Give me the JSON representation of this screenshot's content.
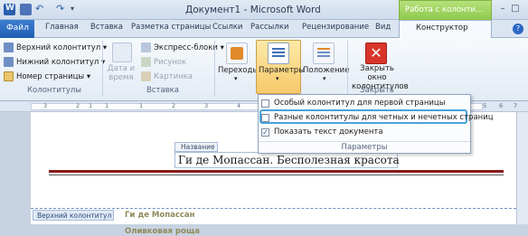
{
  "window": {
    "title": "Документ1  -  Microsoft Word",
    "context_tab": "Работа с колонти..."
  },
  "tabs": [
    "Главная",
    "Вставка",
    "Разметка страницы",
    "Ссылки",
    "Рассылки",
    "Рецензирование",
    "Вид"
  ],
  "file_tab": "Файл",
  "constructor_tab": "Конструктор",
  "ribbon": {
    "kolontituly": {
      "items": [
        "Верхний колонтитул ▾",
        "Нижний колонтитул ▾",
        "Номер страницы ▾"
      ],
      "label": "Колонтитулы"
    },
    "vstavka": {
      "date_time": [
        "Дата и",
        "время"
      ],
      "express": "Экспресс-блоки ▾",
      "picture": "Рисунок",
      "clipart": "Картинка",
      "label": "Вставка"
    },
    "perehody": "Переходы",
    "parametry": "Параметры",
    "polozhenie": "Положение",
    "close": [
      "Закрыть окно",
      "колонтитулов"
    ],
    "close_label": "Закрыть"
  },
  "dropdown": {
    "items": [
      {
        "label": "Особый колонтитул для первой страницы",
        "checked": false
      },
      {
        "label": "Разные колонтитулы для четных и нечетных страниц",
        "checked": false
      },
      {
        "label": "Показать текст документа",
        "checked": true
      }
    ],
    "footer": "Параметры"
  },
  "ruler_numbers": [
    "3",
    "1",
    "2",
    "1",
    "1",
    "2",
    "3",
    "4",
    "5",
    "6",
    "7"
  ],
  "document": {
    "name_tag": "Название",
    "title": "Ги де Мопассан. Бесполезная красота",
    "header_tag": "Верхний колонтитул",
    "author": "Ги де Мопассан",
    "subtitle": "Оливковая роща"
  },
  "colors": {
    "accent": "#2a5fa8",
    "context_green": "#8ec84d",
    "olive_text": "#8f8a5a",
    "dropdown_highlight": "#4aa3d9"
  }
}
